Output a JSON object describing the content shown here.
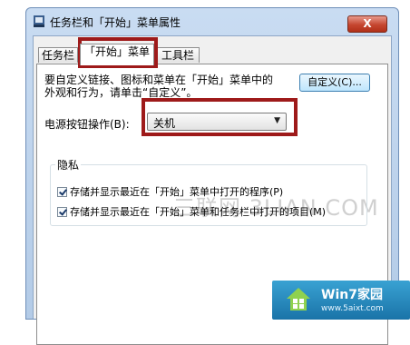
{
  "window": {
    "title": "任务栏和「开始」菜单属性",
    "close_label": "X"
  },
  "tabs": [
    {
      "label": "任务栏"
    },
    {
      "label": "「开始」菜单"
    },
    {
      "label": "工具栏"
    }
  ],
  "start_menu": {
    "description_line1": "要自定义链接、图标和菜单在「开始」菜单中的",
    "description_line2": "外观和行为，请单击“自定义”。",
    "customize_label": "自定义(C)...",
    "power_label": "电源按钮操作(B):",
    "power_value": "关机"
  },
  "privacy": {
    "title": "隐私",
    "items": [
      {
        "label": "存储并显示最近在「开始」菜单中打开的程序(P)",
        "checked": true
      },
      {
        "label": "存储并显示最近在「开始」菜单和任务栏中打开的项目(M)",
        "checked": true
      }
    ]
  },
  "watermark": "三联网 3LIAN.COM",
  "logo": {
    "title": "Win7家园",
    "url_text": "www.5aixt.com"
  },
  "colors": {
    "highlight": "#9e1a1a",
    "titlebar": "#c9dcf2",
    "close_button": "#c5462f",
    "logo_bg": "#1a73a8"
  }
}
